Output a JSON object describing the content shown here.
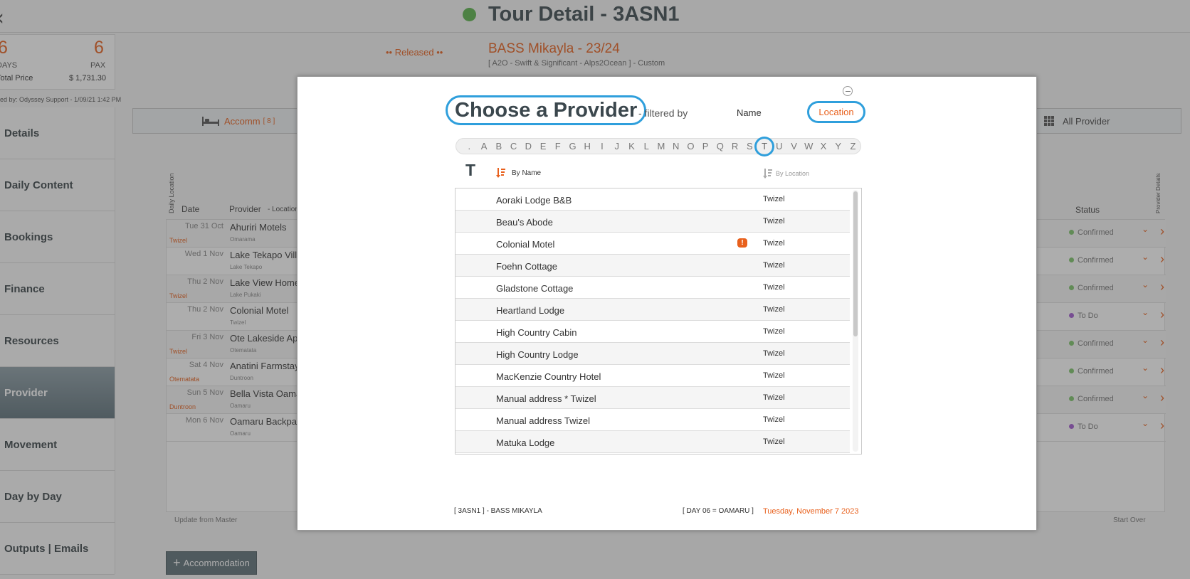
{
  "header": {
    "title": "Tour Detail - 3ASN1"
  },
  "stats": {
    "days_value": "6",
    "days_label": "DAYS",
    "pax_value": "6",
    "pax_label": "PAX",
    "price_label": "Total Price",
    "price_value": "$ 1,731.30",
    "created_by": "ed by: Odyssey Support - 1/09/21 1:42 PM"
  },
  "tour": {
    "released": "•• Released ••",
    "name": "BASS Mikayla - 23/24",
    "subtitle": "[ A2O - Swift & Significant - Alps2Ocean ] - Custom"
  },
  "sidebar": {
    "items": [
      "Details",
      "Daily Content",
      "Bookings",
      "Finance",
      "Resources",
      "Provider",
      "Movement",
      "Day by Day",
      "Outputs | Emails"
    ]
  },
  "tabs": {
    "accomm_label": "Accomm",
    "accomm_count": "[ 8 ]",
    "all_label": "All Provider"
  },
  "grid": {
    "head_date": "Date",
    "head_provider": "Provider",
    "head_location": "- Location",
    "head_daily_location": "Daily Location",
    "head_status": "Status",
    "head_provider_details": "Provider Details",
    "rows": [
      {
        "date": "Tue 31 Oct",
        "loc": "Twizel",
        "provider": "Ahuriri Motels",
        "sub": "Omarama",
        "status": "Confirmed"
      },
      {
        "date": "Wed 1 Nov",
        "loc": "",
        "provider": "Lake Tekapo Villa",
        "sub": "Lake Tekapo",
        "status": "Confirmed"
      },
      {
        "date": "Thu 2 Nov",
        "loc": "Twizel",
        "provider": "Lake View Home",
        "sub": "Lake Pukaki",
        "status": "Confirmed"
      },
      {
        "date": "Thu 2 Nov",
        "loc": "",
        "provider": "Colonial Motel",
        "sub": "Twizel",
        "status": "To Do"
      },
      {
        "date": "Fri 3 Nov",
        "loc": "Twizel",
        "provider": "Ote Lakeside Ap",
        "sub": "Otematata",
        "status": "Confirmed"
      },
      {
        "date": "Sat 4 Nov",
        "loc": "Otematata",
        "provider": "Anatini Farmstay",
        "sub": "Duntroon",
        "status": "Confirmed"
      },
      {
        "date": "Sun 5 Nov",
        "loc": "Duntroon",
        "provider": "Bella Vista Oama",
        "sub": "Oamaru",
        "status": "Confirmed"
      },
      {
        "date": "Mon 6 Nov",
        "loc": "",
        "provider": "Oamaru Backpac",
        "sub": "Oamaru",
        "status": "To Do"
      }
    ],
    "update_from_master": "Update from Master",
    "start_over": "Start Over",
    "add_accommodation": "Accommodation"
  },
  "colors": {
    "accent": "#e8601c",
    "highlight": "#2f9fdc",
    "confirmed": "#7cc46a",
    "todo": "#a25bd0"
  },
  "modal": {
    "title": "Choose a Provider",
    "filtered_by": "- filtered by",
    "filter_name": "Name",
    "filter_location": "Location",
    "alphabet": [
      ".",
      "A",
      "B",
      "C",
      "D",
      "E",
      "F",
      "G",
      "H",
      "I",
      "J",
      "K",
      "L",
      "M",
      "N",
      "O",
      "P",
      "Q",
      "R",
      "S",
      "T",
      "U",
      "V",
      "W",
      "X",
      "Y",
      "Z"
    ],
    "selected_letter": "T",
    "sort_by_name": "By Name",
    "sort_by_location": "By Location",
    "providers": [
      {
        "name": "Aoraki Lodge B&B",
        "location": "Twizel",
        "warning": false
      },
      {
        "name": "Beau's Abode",
        "location": "Twizel",
        "warning": false
      },
      {
        "name": "Colonial Motel",
        "location": "Twizel",
        "warning": true
      },
      {
        "name": "Foehn Cottage",
        "location": "Twizel",
        "warning": false
      },
      {
        "name": "Gladstone Cottage",
        "location": "Twizel",
        "warning": false
      },
      {
        "name": "Heartland Lodge",
        "location": "Twizel",
        "warning": false
      },
      {
        "name": "High Country Cabin",
        "location": "Twizel",
        "warning": false
      },
      {
        "name": "High Country Lodge",
        "location": "Twizel",
        "warning": false
      },
      {
        "name": "MacKenzie Country Hotel",
        "location": "Twizel",
        "warning": false
      },
      {
        "name": "Manual address * Twizel",
        "location": "Twizel",
        "warning": false
      },
      {
        "name": "Manual address Twizel",
        "location": "Twizel",
        "warning": false
      },
      {
        "name": "Matuka Lodge",
        "location": "Twizel",
        "warning": false
      }
    ],
    "footer_tour": "[ 3ASN1 ] - BASS MIKAYLA",
    "footer_day": "[ DAY 06 = OAMARU ]",
    "footer_date": "Tuesday, November 7 2023"
  }
}
